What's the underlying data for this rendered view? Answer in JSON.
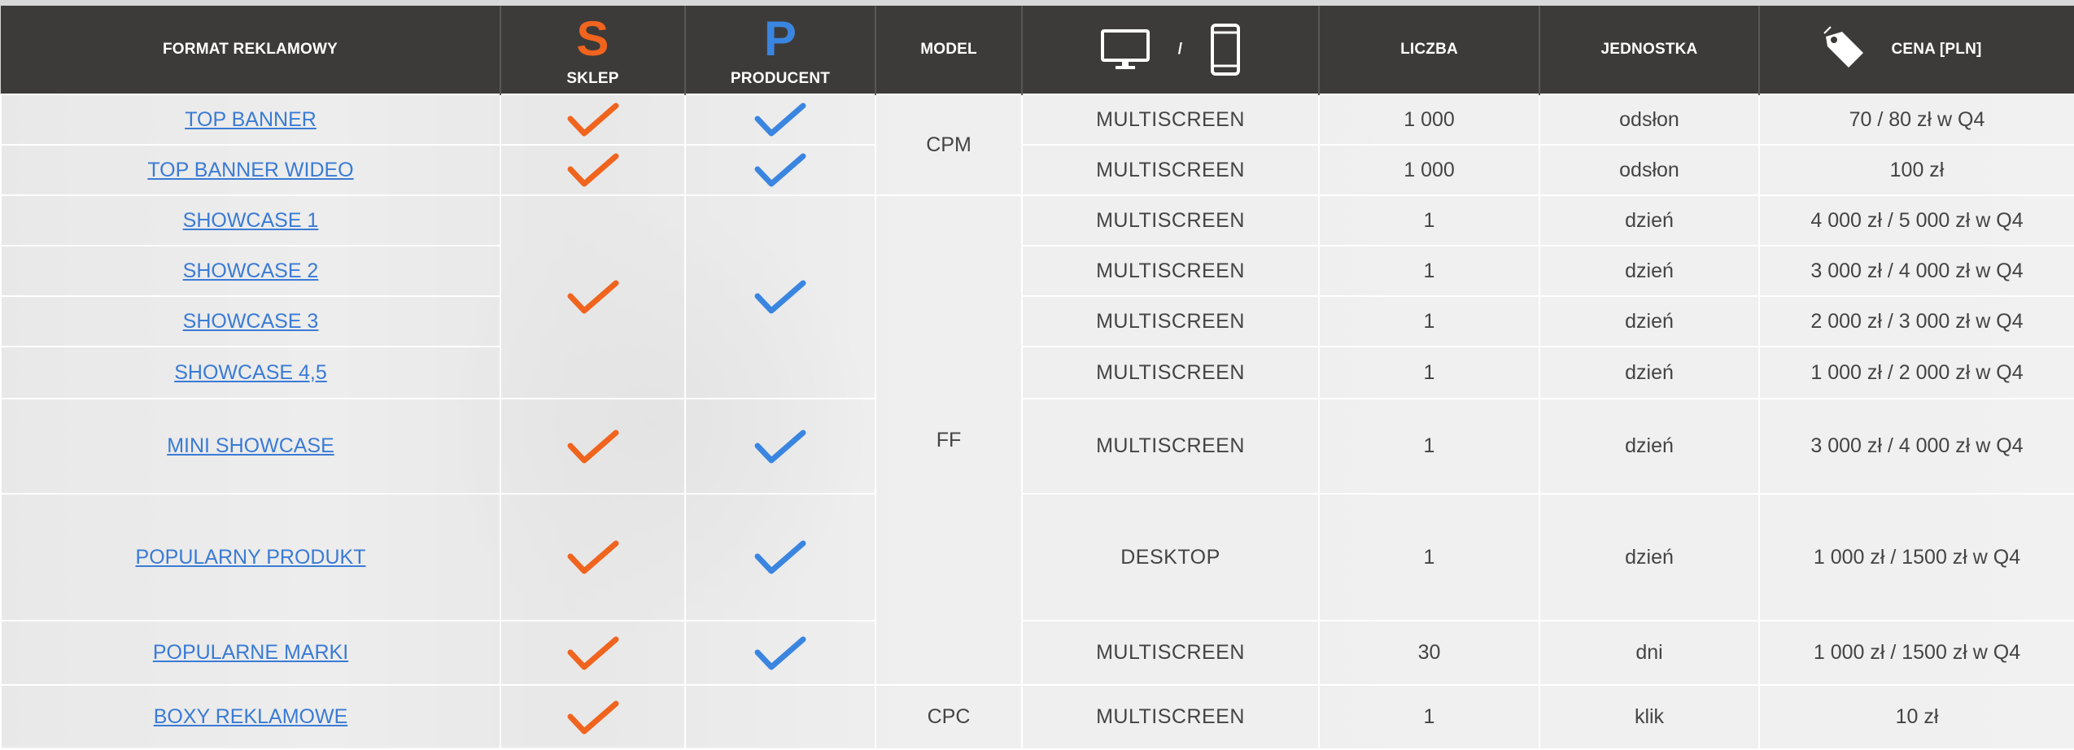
{
  "header": {
    "format": "FORMAT REKLAMOWY",
    "sklep_letter": "S",
    "sklep": "SKLEP",
    "producent_letter": "P",
    "producent": "PRODUCENT",
    "model": "MODEL",
    "device_separator": "/",
    "liczba": "LICZBA",
    "jednostka": "JEDNOSTKA",
    "cena": "CENA [PLN]"
  },
  "icons": {
    "monitor": "monitor-icon",
    "phone": "smartphone-icon",
    "tag": "price-tag-icon",
    "check": "checkmark-icon"
  },
  "colors": {
    "header_bg": "#3d3b39",
    "sklep": "#f0641e",
    "producent": "#3a85e0",
    "link": "#3a7bd5"
  },
  "models": {
    "cpm": "CPM",
    "ff": "FF",
    "cpc": "CPC"
  },
  "rows": [
    {
      "format": "TOP BANNER",
      "device": "MULTISCREEN",
      "count": "1 000",
      "unit": "odsłon",
      "price": "70 / 80 zł w Q4"
    },
    {
      "format": "TOP BANNER WIDEO",
      "device": "MULTISCREEN",
      "count": "1 000",
      "unit": "odsłon",
      "price": "100 zł"
    },
    {
      "format": "SHOWCASE 1",
      "device": "MULTISCREEN",
      "count": "1",
      "unit": "dzień",
      "price": "4 000 zł / 5 000 zł w Q4"
    },
    {
      "format": "SHOWCASE 2",
      "device": "MULTISCREEN",
      "count": "1",
      "unit": "dzień",
      "price": "3 000 zł / 4 000 zł w Q4"
    },
    {
      "format": "SHOWCASE 3",
      "device": "MULTISCREEN",
      "count": "1",
      "unit": "dzień",
      "price": "2 000 zł / 3 000 zł w Q4"
    },
    {
      "format": "SHOWCASE 4,5",
      "device": "MULTISCREEN",
      "count": "1",
      "unit": "dzień",
      "price": "1 000 zł / 2 000 zł w Q4"
    },
    {
      "format": "MINI SHOWCASE",
      "device": "MULTISCREEN",
      "count": "1",
      "unit": "dzień",
      "price": "3 000 zł / 4 000 zł w Q4"
    },
    {
      "format": "POPULARNY PRODUKT",
      "device": "DESKTOP",
      "count": "1",
      "unit": "dzień",
      "price": "1 000 zł / 1500 zł w Q4"
    },
    {
      "format": "POPULARNE MARKI",
      "device": "MULTISCREEN",
      "count": "30",
      "unit": "dni",
      "price": "1 000 zł / 1500 zł w Q4"
    },
    {
      "format": "BOXY REKLAMOWE",
      "device": "MULTISCREEN",
      "count": "1",
      "unit": "klik",
      "price": "10 zł"
    }
  ]
}
